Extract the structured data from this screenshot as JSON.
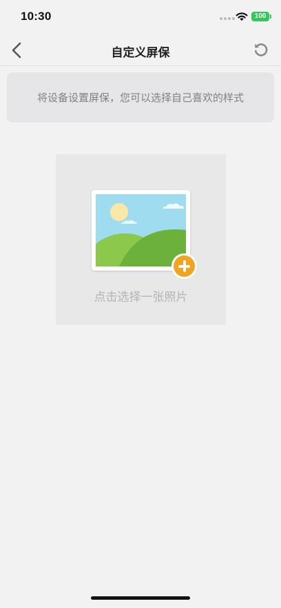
{
  "status_bar": {
    "time": "10:30",
    "battery": "100",
    "icons": [
      "signal-dots-icon",
      "wifi-icon",
      "battery-icon"
    ]
  },
  "nav": {
    "title": "自定义屏保",
    "back_icon": "chevron-left-icon",
    "reset_icon": "reset-icon"
  },
  "tip": {
    "text": "将设备设置屏保，您可以选择自己喜欢的样式"
  },
  "picker": {
    "label": "点击选择一张照片",
    "image_icon": "landscape-image-icon",
    "add_icon": "add-circle-icon"
  },
  "colors": {
    "background": "#f2f2f2",
    "tip_background": "#e6e6e8",
    "picker_background": "#e8e8e8",
    "accent": "#f0a422",
    "battery": "#34c759"
  }
}
